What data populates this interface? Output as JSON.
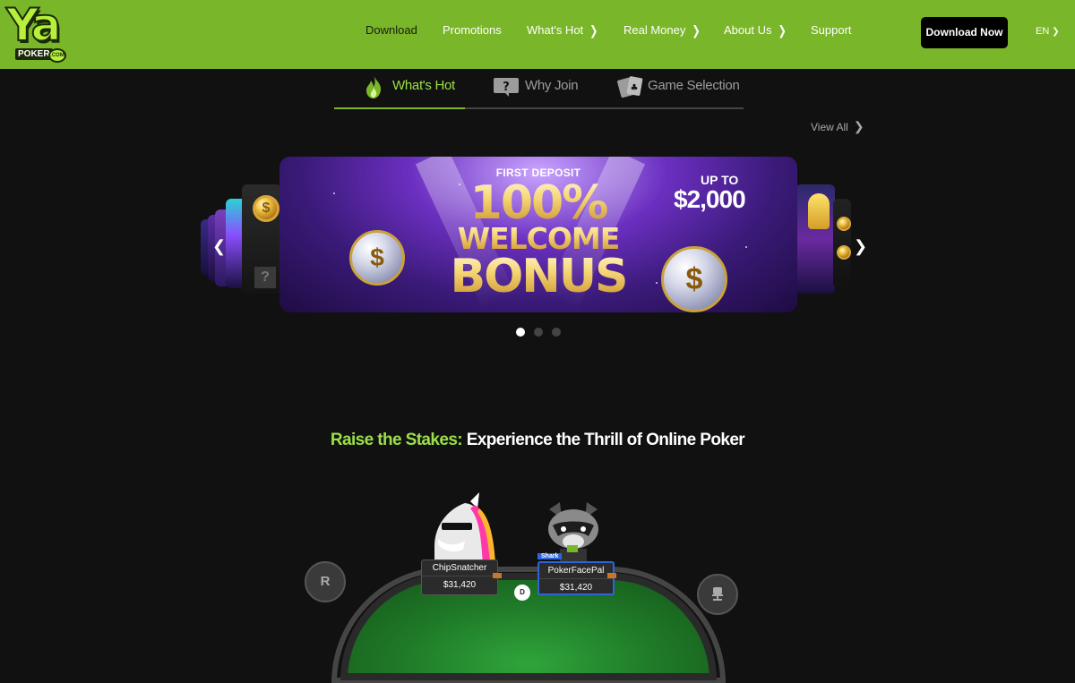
{
  "header": {
    "logo": {
      "main": "Ya",
      "sub": "POKER",
      "badge": ".COM"
    },
    "nav": [
      {
        "label": "Download",
        "has_chevron": false,
        "active": true
      },
      {
        "label": "Promotions",
        "has_chevron": false,
        "active": false
      },
      {
        "label": "What's Hot",
        "has_chevron": true,
        "active": false
      },
      {
        "label": "Real Money",
        "has_chevron": true,
        "active": false
      },
      {
        "label": "About Us",
        "has_chevron": true,
        "active": false
      },
      {
        "label": "Support",
        "has_chevron": false,
        "active": false
      }
    ],
    "download_button": "Download Now",
    "language": "EN",
    "colors": {
      "bar": "#7ab62a"
    }
  },
  "tabs": [
    {
      "label": "What's Hot",
      "icon": "flame-icon",
      "active": true
    },
    {
      "label": "Why Join",
      "icon": "question-card-icon",
      "active": false
    },
    {
      "label": "Game Selection",
      "icon": "cards-icon",
      "active": false
    }
  ],
  "view_all": "View All",
  "carousel": {
    "banner": {
      "kicker": "FIRST DEPOSIT",
      "headline_1": "100%",
      "headline_2": "WELCOME",
      "headline_3": "BONUS",
      "up_to": "UP TO",
      "amount": "$2,000"
    },
    "slide_count": 3,
    "active_slide": 1
  },
  "headline": {
    "green_part": "Raise the Stakes:",
    "white_part": " Experience the Thrill of Online Poker"
  },
  "table": {
    "players": [
      {
        "name": "ChipSnatcher",
        "stack": "$31,420",
        "tag": ""
      },
      {
        "name": "PokerFacePal",
        "stack": "$31,420",
        "tag": "Shark"
      }
    ],
    "left_button": "R"
  }
}
